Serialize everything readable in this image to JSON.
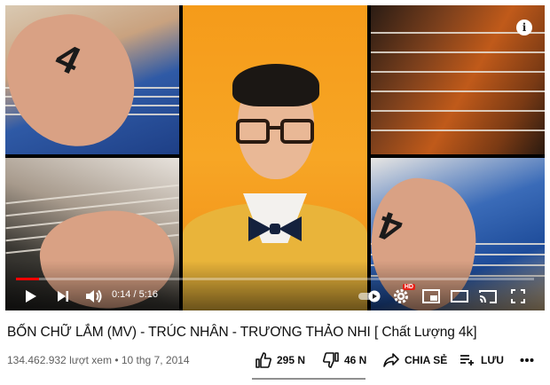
{
  "player": {
    "info_icon": "info-icon",
    "time_current": "0:14",
    "time_separator": " / ",
    "time_total": "5:16",
    "progress_fraction": 0.045,
    "accent_color": "#ff0000",
    "hd_badge": "HD",
    "overlay_number_left": "4",
    "overlay_number_right": "4"
  },
  "video": {
    "title": "BỐN CHỮ LẮM (MV) - TRÚC NHÂN - TRƯƠNG THẢO NHI [ Chất Lượng 4k]",
    "views": "134.462.932 lượt xem",
    "meta_separator": " • ",
    "date": "10 thg 7, 2014"
  },
  "actions": {
    "like_count": "295 N",
    "dislike_count": "46 N",
    "share_label": "CHIA SẺ",
    "save_label": "LƯU",
    "more_icon": "more-horiz-icon"
  }
}
